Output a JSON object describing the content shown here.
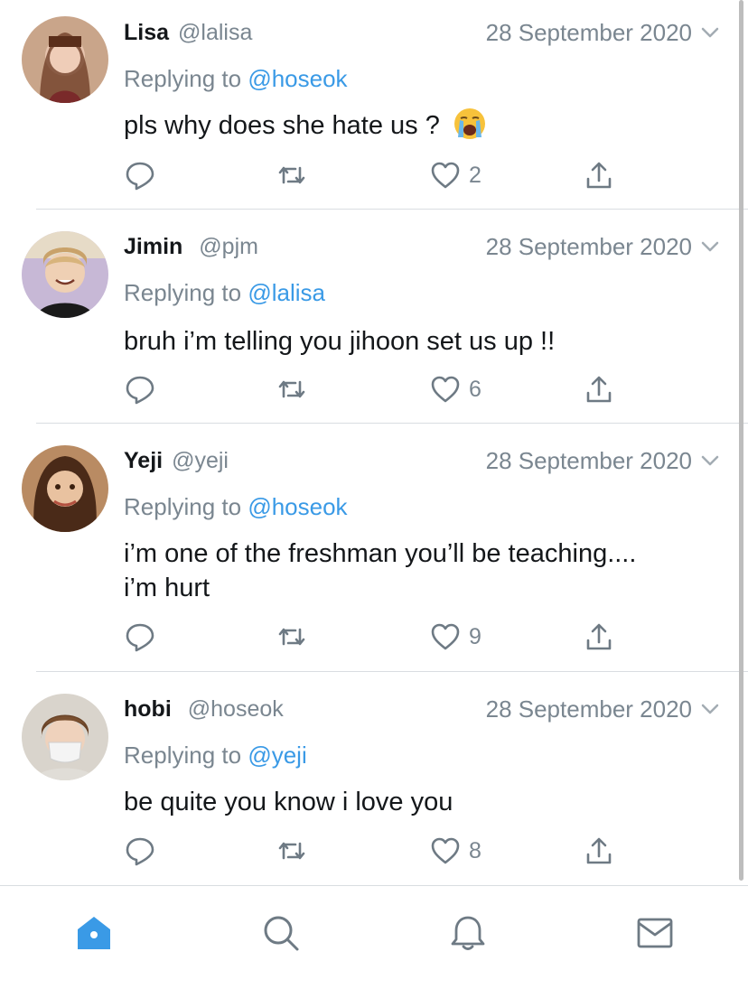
{
  "tweets": [
    {
      "name": "Lisa",
      "handle": "@lalisa",
      "date": "28 September 2020",
      "replying_label": "Replying to",
      "replying_handle": "@hoseok",
      "text": "pls why does she hate us ?",
      "emoji": "loudly-crying-face",
      "likes": "2"
    },
    {
      "name": "Jimin",
      "handle": "@pjm",
      "date": "28 September 2020",
      "replying_label": "Replying to",
      "replying_handle": "@lalisa",
      "text": "bruh i’m telling you jihoon set us up !!",
      "likes": "6"
    },
    {
      "name": "Yeji",
      "handle": "@yeji",
      "date": "28 September 2020",
      "replying_label": "Replying to",
      "replying_handle": "@hoseok",
      "text_line1": "i’m one of the freshman you’ll be teaching....",
      "text_line2": "i’m hurt",
      "likes": "9"
    },
    {
      "name": "hobi",
      "handle": "@hoseok",
      "date": "28 September 2020",
      "replying_label": "Replying to",
      "replying_handle": "@yeji",
      "text": "be quite you know i love you",
      "likes": "8"
    }
  ],
  "tabbar": {
    "items": [
      "home-icon",
      "search-icon",
      "notifications-icon",
      "messages-icon"
    ],
    "active": "home-icon"
  },
  "colors": {
    "accent": "#3a9ae6",
    "secondary_text": "#7a8690",
    "icon": "#6e7a84",
    "divider": "#d9dde1"
  }
}
